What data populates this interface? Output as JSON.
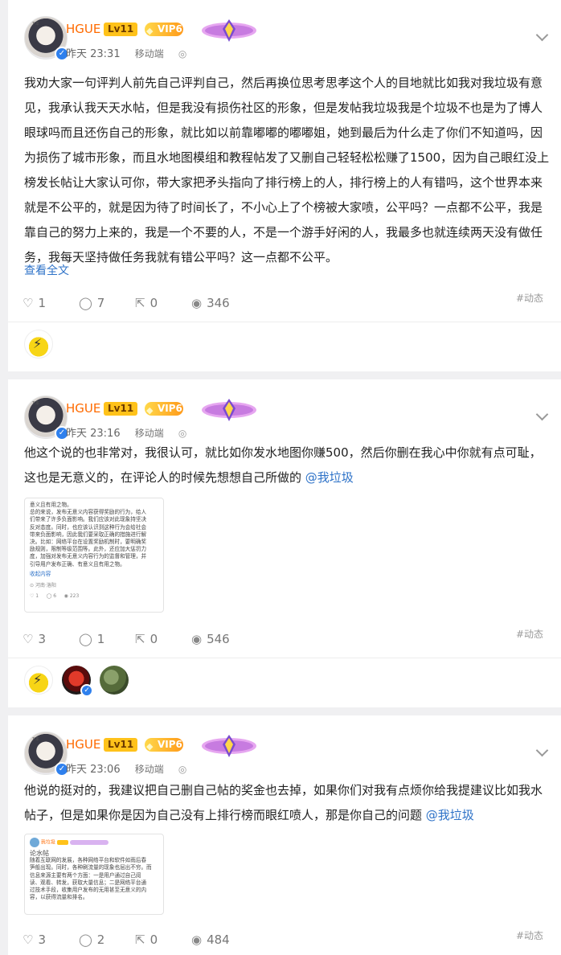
{
  "posts": [
    {
      "user": {
        "name": "HGUE",
        "level": "Lv11",
        "vip": "VIP6",
        "avatar_tag": "下本"
      },
      "time": "昨天 23:31",
      "source": "移动端",
      "content": "我劝大家一句评判人前先自己评判自己，然后再换位思考思孝这个人的目地就比如我对我垃圾有意见，我承认我天天水帖，但是我没有损伤社区的形象，但是发帖我垃圾我是个垃圾不也是为了博人眼球吗而且还伤自己的形象，就比如以前靠嘟嘟的嘟嘟姐，她到最后为什么走了你们不知道吗，因为损伤了城市形象，而且水地图模组和教程帖发了又删自己轻轻松松赚了1500，因为自己眼红没上榜发长帖让大家认可你，带大家把矛头指向了排行榜上的人，排行榜上的人有错吗，这个世界本来就是不公平的，就是因为待了时间长了，不小心上了个榜被大家喷，公平吗？一点都不公平，我是靠自己的努力上来的，我是一个不要的人，不是一个游手好闲的人，我最多也就连续两天没有做任务，我每天坚持做任务我就有错公平吗？这一点都不公平。",
      "expand": "查看全文",
      "likes": "1",
      "comments": "7",
      "shares": "0",
      "views": "346",
      "tag": "#动态"
    },
    {
      "user": {
        "name": "HGUE",
        "level": "Lv11",
        "vip": "VIP6",
        "avatar_tag": "下本"
      },
      "time": "昨天 23:16",
      "source": "移动端",
      "content": "他这个说的也非常对，我很认可，就比如你发水地图你赚500，然后你删在我心中你就有点可耻，这也是无意义的，在评论人的时候先想想自己所做的 ",
      "mention": "@我垃圾",
      "image": {
        "lines": [
          "意义且有用之物。",
          "总的来说，发布无意义内容获得奖励的行为，给人",
          "们带来了许多负面影响。我们应该对此现象持坚决",
          "反对态度。同时，也应该认识到这种行为会给社会",
          "带来负面影响，因此我们要采取正确的措施进行解",
          "决。比如：网络平台在设置奖励机制时，要明确奖",
          "励规则，限制等级范围等。此外，还应加大惩罚力",
          "度，加强对发布无意义内容行为的监督和管理，并",
          "引导用户发布正确、有意义且有用之物。"
        ],
        "collapse": "收起内容",
        "location": "河南·洛阳",
        "stats": [
          "1",
          "6",
          "223"
        ]
      },
      "likes": "3",
      "comments": "1",
      "shares": "0",
      "views": "546",
      "tag": "#动态"
    },
    {
      "user": {
        "name": "HGUE",
        "level": "Lv11",
        "vip": "VIP6",
        "avatar_tag": "下本"
      },
      "time": "昨天 23:06",
      "source": "移动端",
      "content": "他说的挺对的，我建议把自己删自己帖的奖金也去掉，如果你们对我有点烦你给我提建议比如我水帖子，但是如果你是因为自己没有上排行榜而眼红喷人，那是你自己的问题 ",
      "mention": "@我垃圾",
      "image": {
        "header": "我垃圾",
        "title": "论水帖",
        "lines": [
          "随着互联网的发展，各种网络平台和软件如雨后春",
          "笋般出现。同时，各种刷流量的现象也层出不穷。而",
          "信息来源主要有两个方面：一是用户通过自己阅",
          "读、观看、转发，获取大量信息；二是网络平台通",
          "过技术手段，收集用户发布的无用甚至无意义的内",
          "容，以获得流量和排名。"
        ]
      },
      "likes": "3",
      "comments": "2",
      "shares": "0",
      "views": "484",
      "tag": "#动态"
    }
  ]
}
